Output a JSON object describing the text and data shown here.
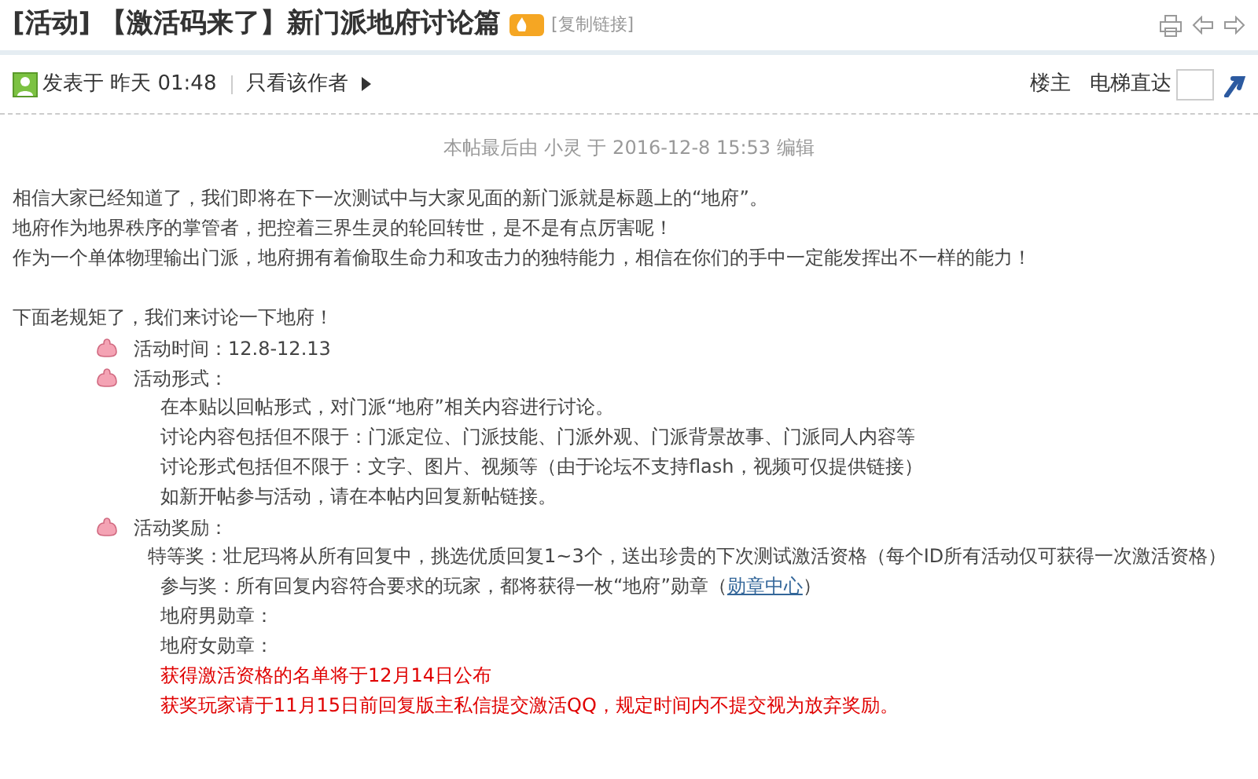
{
  "header": {
    "title": "[活动] 【激活码来了】新门派地府讨论篇",
    "copy_link": "[复制链接]"
  },
  "meta": {
    "posted": "发表于 昨天 01:48",
    "only_author": "只看该作者",
    "floor": "楼主",
    "jump_label": "电梯直达"
  },
  "edit_note": "本帖最后由 小灵 于 2016-12-8 15:53 编辑",
  "body": [
    {
      "kind": "text",
      "text": "相信大家已经知道了，我们即将在下一次测试中与大家见面的新门派就是标题上的“地府”。"
    },
    {
      "kind": "text",
      "text": "地府作为地界秩序的掌管者，把控着三界生灵的轮回转世，是不是有点厉害呢！"
    },
    {
      "kind": "text",
      "text": "作为一个单体物理输出门派，地府拥有着偷取生命力和攻击力的独特能力，相信在你们的手中一定能发挥出不一样的能力！"
    },
    {
      "kind": "gap"
    },
    {
      "kind": "text",
      "text": "下面老规矩了，我们来讨论一下地府！"
    },
    {
      "kind": "bullet",
      "text": "活动时间：12.8-12.13"
    },
    {
      "kind": "bullet",
      "text": "活动形式："
    },
    {
      "kind": "sub",
      "text": "在本贴以回帖形式，对门派“地府”相关内容进行讨论。"
    },
    {
      "kind": "sub",
      "text": "讨论内容包括但不限于：门派定位、门派技能、门派外观、门派背景故事、门派同人内容等"
    },
    {
      "kind": "sub",
      "text": "讨论形式包括但不限于：文字、图片、视频等（由于论坛不支持flash，视频可仅提供链接）"
    },
    {
      "kind": "sub",
      "text": "如新开帖参与活动，请在本帖内回复新帖链接。"
    },
    {
      "kind": "bullet",
      "text": "活动奖励："
    },
    {
      "kind": "wrap",
      "text": "特等奖：壮尼玛将从所有回复中，挑选优质回复1~3个，送出珍贵的下次测试激活资格（每个ID所有活动仅可获得一次激活资格）"
    },
    {
      "kind": "sub",
      "text": "参与奖：所有回复内容符合要求的玩家，都将获得一枚“地府”勋章（",
      "link": "勋章中心",
      "after": "）"
    },
    {
      "kind": "sub",
      "text": "地府男勋章："
    },
    {
      "kind": "sub",
      "text": "地府女勋章："
    },
    {
      "kind": "notice",
      "text": "获得激活资格的名单将于12月14日公布"
    },
    {
      "kind": "notice",
      "text": "获奖玩家请于11月15日前回复版主私信提交激活QQ，规定时间内不提交视为放弃奖励。"
    }
  ]
}
